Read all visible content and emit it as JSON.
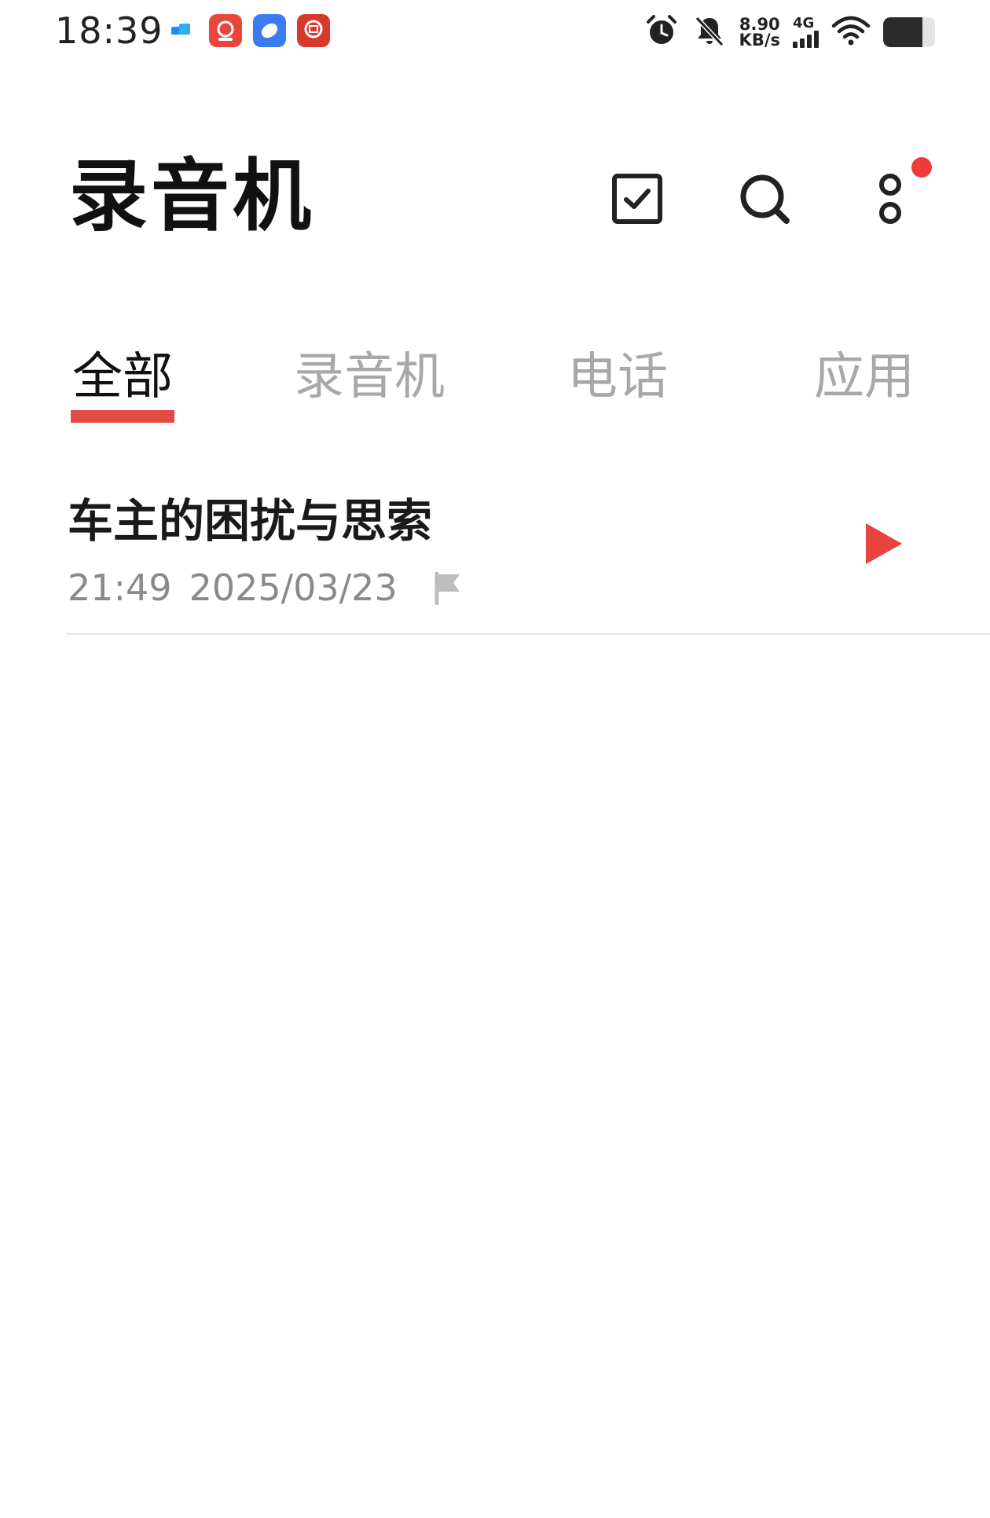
{
  "status_bar": {
    "time": "18:39",
    "notification_icons": [
      "message-app-icon",
      "taobao-icon",
      "browser-icon",
      "bank-icon"
    ],
    "net_speed_value": "8.90",
    "net_speed_unit": "KB/s",
    "net_type": "4G",
    "icons": [
      "alarm-icon",
      "bell-off-icon",
      "signal-icon",
      "wifi-icon",
      "battery-icon"
    ],
    "battery_level": 0.75
  },
  "header": {
    "title": "录音机",
    "actions": [
      "select-icon",
      "search-icon",
      "more-icon"
    ],
    "has_notification_dot": true
  },
  "tabs": [
    {
      "label": "全部",
      "active": true
    },
    {
      "label": "录音机",
      "active": false
    },
    {
      "label": "电话",
      "active": false
    },
    {
      "label": "应用",
      "active": false
    }
  ],
  "recordings": [
    {
      "title": "车主的困扰与思索",
      "time": "21:49",
      "date": "2025/03/23"
    }
  ],
  "colors": {
    "accent": "#e24a45",
    "play": "#e8433e",
    "text_primary": "#111111",
    "text_secondary": "#8a8a8a",
    "tab_inactive": "#a8a8a8"
  }
}
